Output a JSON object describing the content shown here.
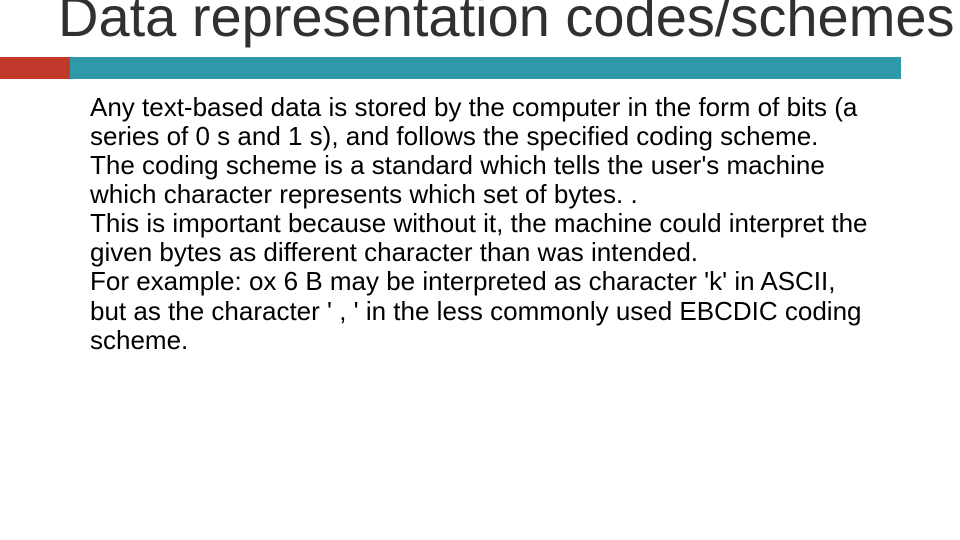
{
  "slide": {
    "title": "Data representation codes/schemes",
    "paragraphs": [
      "Any text-based data is stored by the computer in the form of bits (a series of 0 s and 1 s), and follows the specified coding scheme.",
      "The coding scheme is a standard which tells the user's machine which character represents which set of bytes. .",
      "This is important because without it, the machine could interpret the given bytes as different character than was intended.",
      "For example: ox 6 B may be interpreted as character 'k' in ASCII, but as the character ' , ' in the less commonly used EBCDIC coding scheme."
    ]
  },
  "colors": {
    "accent_red": "#c0392b",
    "accent_teal": "#2e9aa9"
  }
}
